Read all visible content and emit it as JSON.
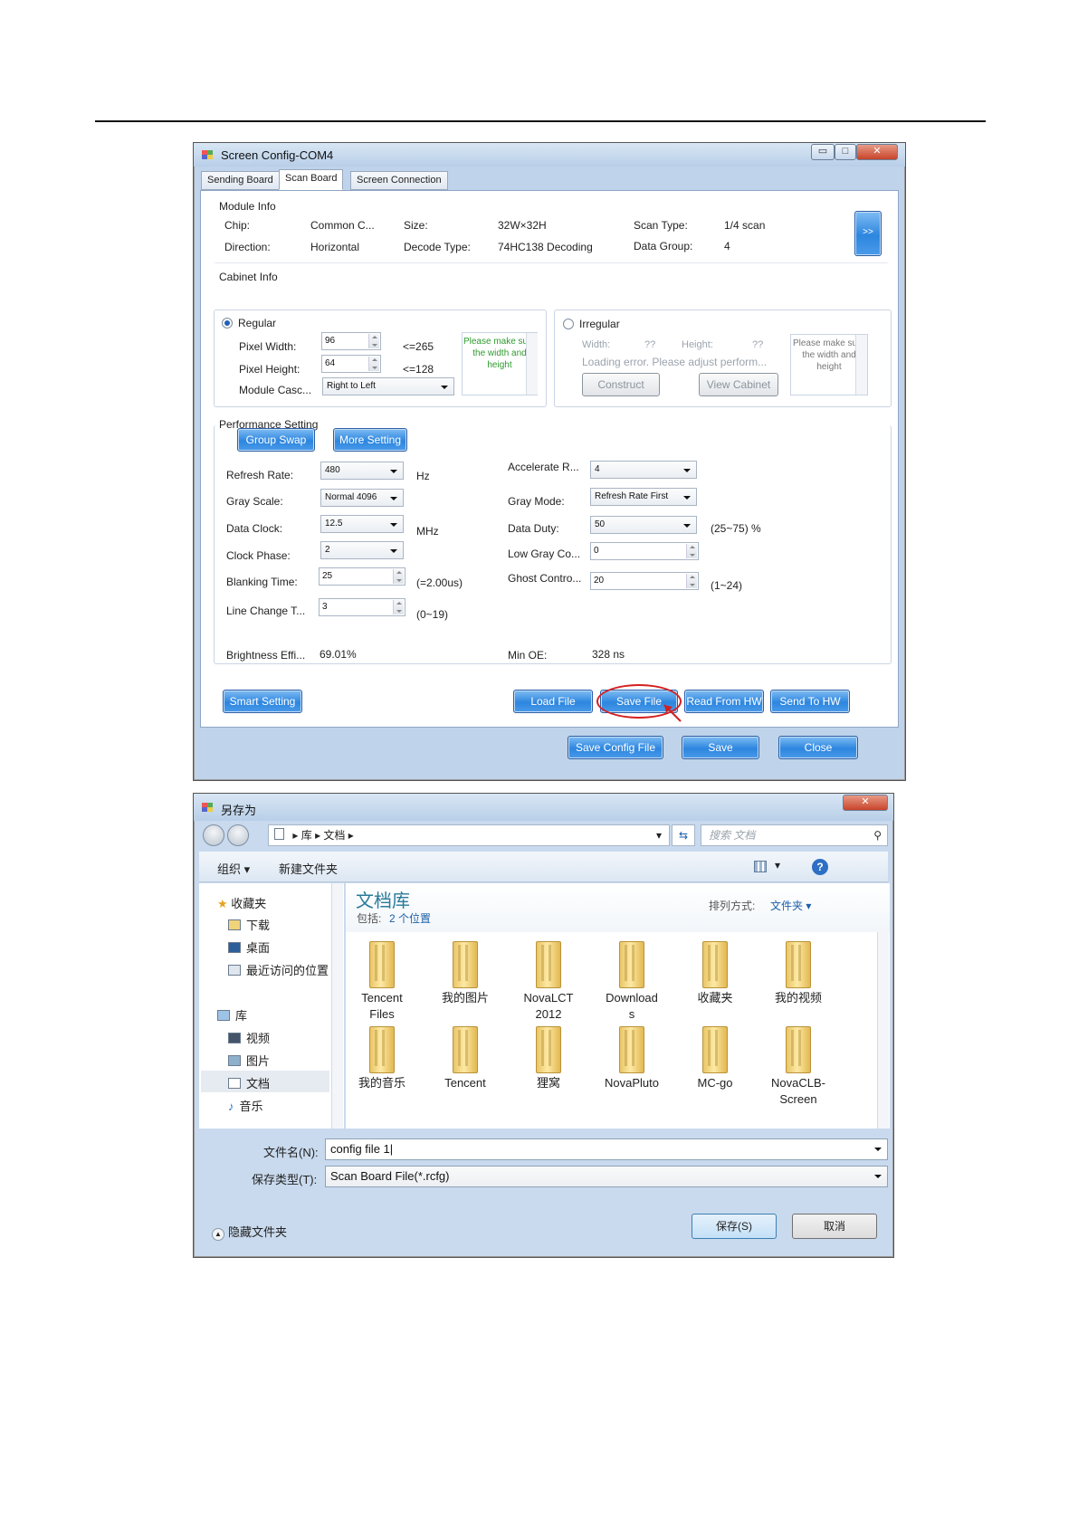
{
  "config_window": {
    "title": "Screen Config-COM4",
    "controls": {
      "minimize": "▭",
      "maximize": "□",
      "close": "✕"
    },
    "tabs": [
      "Sending Board",
      "Scan Board",
      "Screen Connection"
    ],
    "module_info": {
      "heading": "Module Info",
      "chip_label": "Chip:",
      "chip_value": "Common C...",
      "size_label": "Size:",
      "size_value": "32W×32H",
      "scan_type_label": "Scan Type:",
      "scan_type_value": "1/4 scan",
      "direction_label": "Direction:",
      "direction_value": "Horizontal",
      "decode_label": "Decode Type:",
      "decode_value": "74HC138 Decoding",
      "data_group_label": "Data Group:",
      "data_group_value": "4",
      "expand_button": ">>"
    },
    "cabinet_info": {
      "heading": "Cabinet Info",
      "regular": {
        "label": "Regular",
        "pixel_width_label": "Pixel Width:",
        "pixel_width": "96",
        "pixel_width_max": "<=265",
        "pixel_height_label": "Pixel Height:",
        "pixel_height": "64",
        "pixel_height_max": "<=128",
        "cascade_label": "Module Casc...",
        "cascade_value": "Right to Left",
        "note": "Please make sure the width and height"
      },
      "irregular": {
        "label": "Irregular",
        "width_label": "Width:",
        "width_value": "??",
        "height_label": "Height:",
        "height_value": "??",
        "error": "Loading error. Please adjust perform...",
        "construct": "Construct",
        "view_cabinet": "View Cabinet",
        "note": "Please make sure the width and height"
      }
    },
    "performance": {
      "heading": "Performance Setting",
      "group_swap": "Group Swap",
      "more_setting": "More Setting",
      "refresh_label": "Refresh Rate:",
      "refresh_value": "480",
      "refresh_unit": "Hz",
      "gray_scale_label": "Gray Scale:",
      "gray_scale_value": "Normal 4096",
      "data_clock_label": "Data Clock:",
      "data_clock_value": "12.5",
      "data_clock_unit": "MHz",
      "clock_phase_label": "Clock Phase:",
      "clock_phase_value": "2",
      "blanking_label": "Blanking Time:",
      "blanking_value": "25",
      "blanking_unit": "(=2.00us)",
      "line_change_label": "Line Change T...",
      "line_change_value": "3",
      "line_change_range": "(0~19)",
      "brightness_label": "Brightness Effi...",
      "brightness_value": "69.01%",
      "accel_label": "Accelerate R...",
      "accel_value": "4",
      "gray_mode_label": "Gray Mode:",
      "gray_mode_value": "Refresh Rate First",
      "data_duty_label": "Data Duty:",
      "data_duty_value": "50",
      "data_duty_range": "(25~75) %",
      "low_gray_label": "Low Gray Co...",
      "low_gray_value": "0",
      "ghost_label": "Ghost Contro...",
      "ghost_value": "20",
      "ghost_range": "(1~24)",
      "min_oe_label": "Min OE:",
      "min_oe_value": "328 ns"
    },
    "buttons": {
      "smart_setting": "Smart Setting",
      "load_file": "Load File",
      "save_file": "Save File",
      "read_hw": "Read From HW",
      "send_hw": "Send To HW",
      "save_config": "Save Config File",
      "save": "Save",
      "close": "Close"
    }
  },
  "save_dialog": {
    "title": "另存为",
    "breadcrumb": [
      "库",
      "文档"
    ],
    "search_placeholder": "搜索 文档",
    "toolbar": {
      "organize": "组织 ▾",
      "new_folder": "新建文件夹",
      "help": "?"
    },
    "sidebar": {
      "favorites": "收藏夹",
      "downloads": "下载",
      "desktop": "桌面",
      "recent": "最近访问的位置",
      "libraries": "库",
      "videos": "视频",
      "pictures": "图片",
      "documents": "文档",
      "music": "音乐"
    },
    "library_title": "文档库",
    "includes_label": "包括:",
    "includes_value": "2 个位置",
    "sort_label": "排列方式:",
    "sort_value": "文件夹 ▾",
    "folders": [
      [
        "Tencent",
        "Files"
      ],
      [
        "我的图片",
        ""
      ],
      [
        "NovaLCT",
        "2012"
      ],
      [
        "Download",
        "s"
      ],
      [
        "收藏夹",
        ""
      ],
      [
        "我的视频",
        ""
      ],
      [
        "我的音乐",
        ""
      ],
      [
        "Tencent",
        ""
      ],
      [
        "狸窝",
        ""
      ],
      [
        "NovaPluto",
        ""
      ],
      [
        "MC-go",
        ""
      ],
      [
        "NovaCLB-",
        "Screen"
      ]
    ],
    "filename_label": "文件名(N):",
    "filename_value": "config file 1",
    "filetype_label": "保存类型(T):",
    "filetype_value": "Scan Board File(*.rcfg)",
    "hide_folders": "隐藏文件夹",
    "save_button": "保存(S)",
    "cancel_button": "取消",
    "close": "✕"
  },
  "colors": {
    "accent_blue": "#2d86df",
    "highlight_red": "#d42020",
    "title_blue": "#2a7a9a"
  }
}
